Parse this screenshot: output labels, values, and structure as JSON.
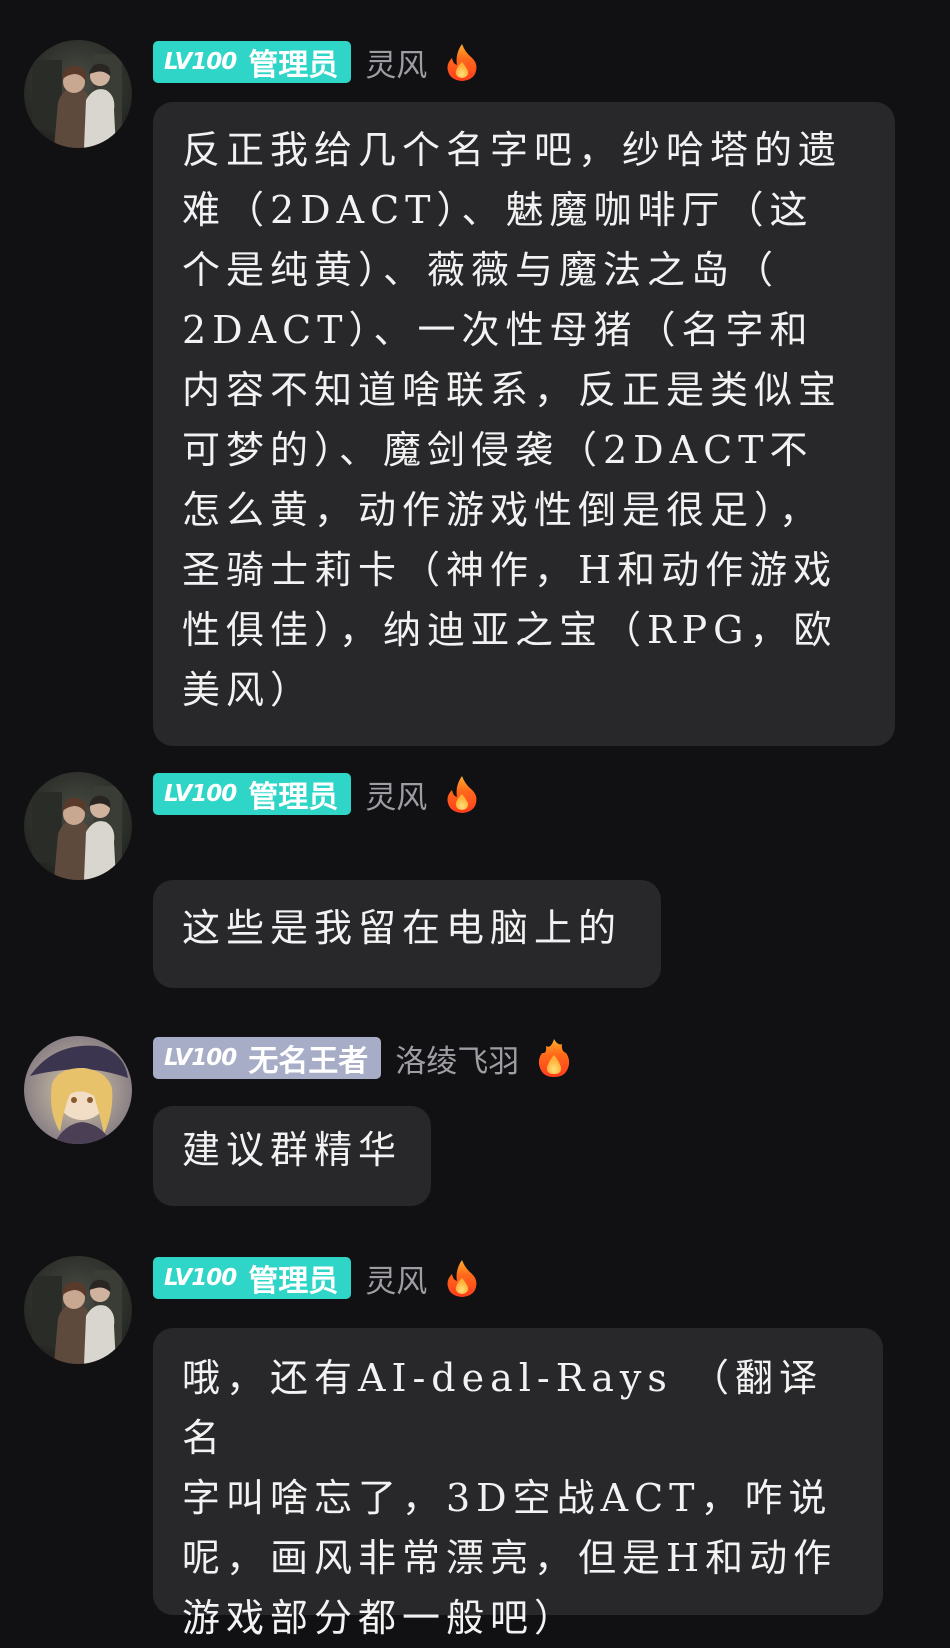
{
  "messages": [
    {
      "level": "LV100",
      "role": "管理员",
      "username": "灵风",
      "text": "反正我给几个名字吧，纱哈塔的遗\n难（2DACT）、魅魔咖啡厅（这\n个是纯黄）、薇薇与魔法之岛（\n2DACT）、一次性母猪（名字和\n内容不知道啥联系，反正是类似宝\n可梦的）、魔剑侵袭（2DACT不\n怎么黄，动作游戏性倒是很足），\n圣骑士莉卡（神作，H和动作游戏\n性俱佳），纳迪亚之宝（RPG，欧\n美风）"
    },
    {
      "level": "LV100",
      "role": "管理员",
      "username": "灵风",
      "text": "这些是我留在电脑上的"
    },
    {
      "level": "LV100",
      "role": "无名王者",
      "username": "洛绫飞羽",
      "text": "建议群精华"
    },
    {
      "level": "LV100",
      "role": "管理员",
      "username": "灵风",
      "text": "哦，还有AI-deal-Rays （翻译名\n字叫啥忘了，3D空战ACT，咋说\n呢，画风非常漂亮，但是H和动作\n游戏部分都一般吧）"
    }
  ],
  "colors": {
    "background": "#111113",
    "bubble": "#28282b",
    "admin_badge": "#2fd6c8",
    "king_badge": "#a7adc6",
    "username": "#9d9da3"
  },
  "icons": {
    "fire": "fire-icon",
    "avatar_admin": "anime-avatar-dark",
    "avatar_king": "anime-avatar-blonde"
  }
}
